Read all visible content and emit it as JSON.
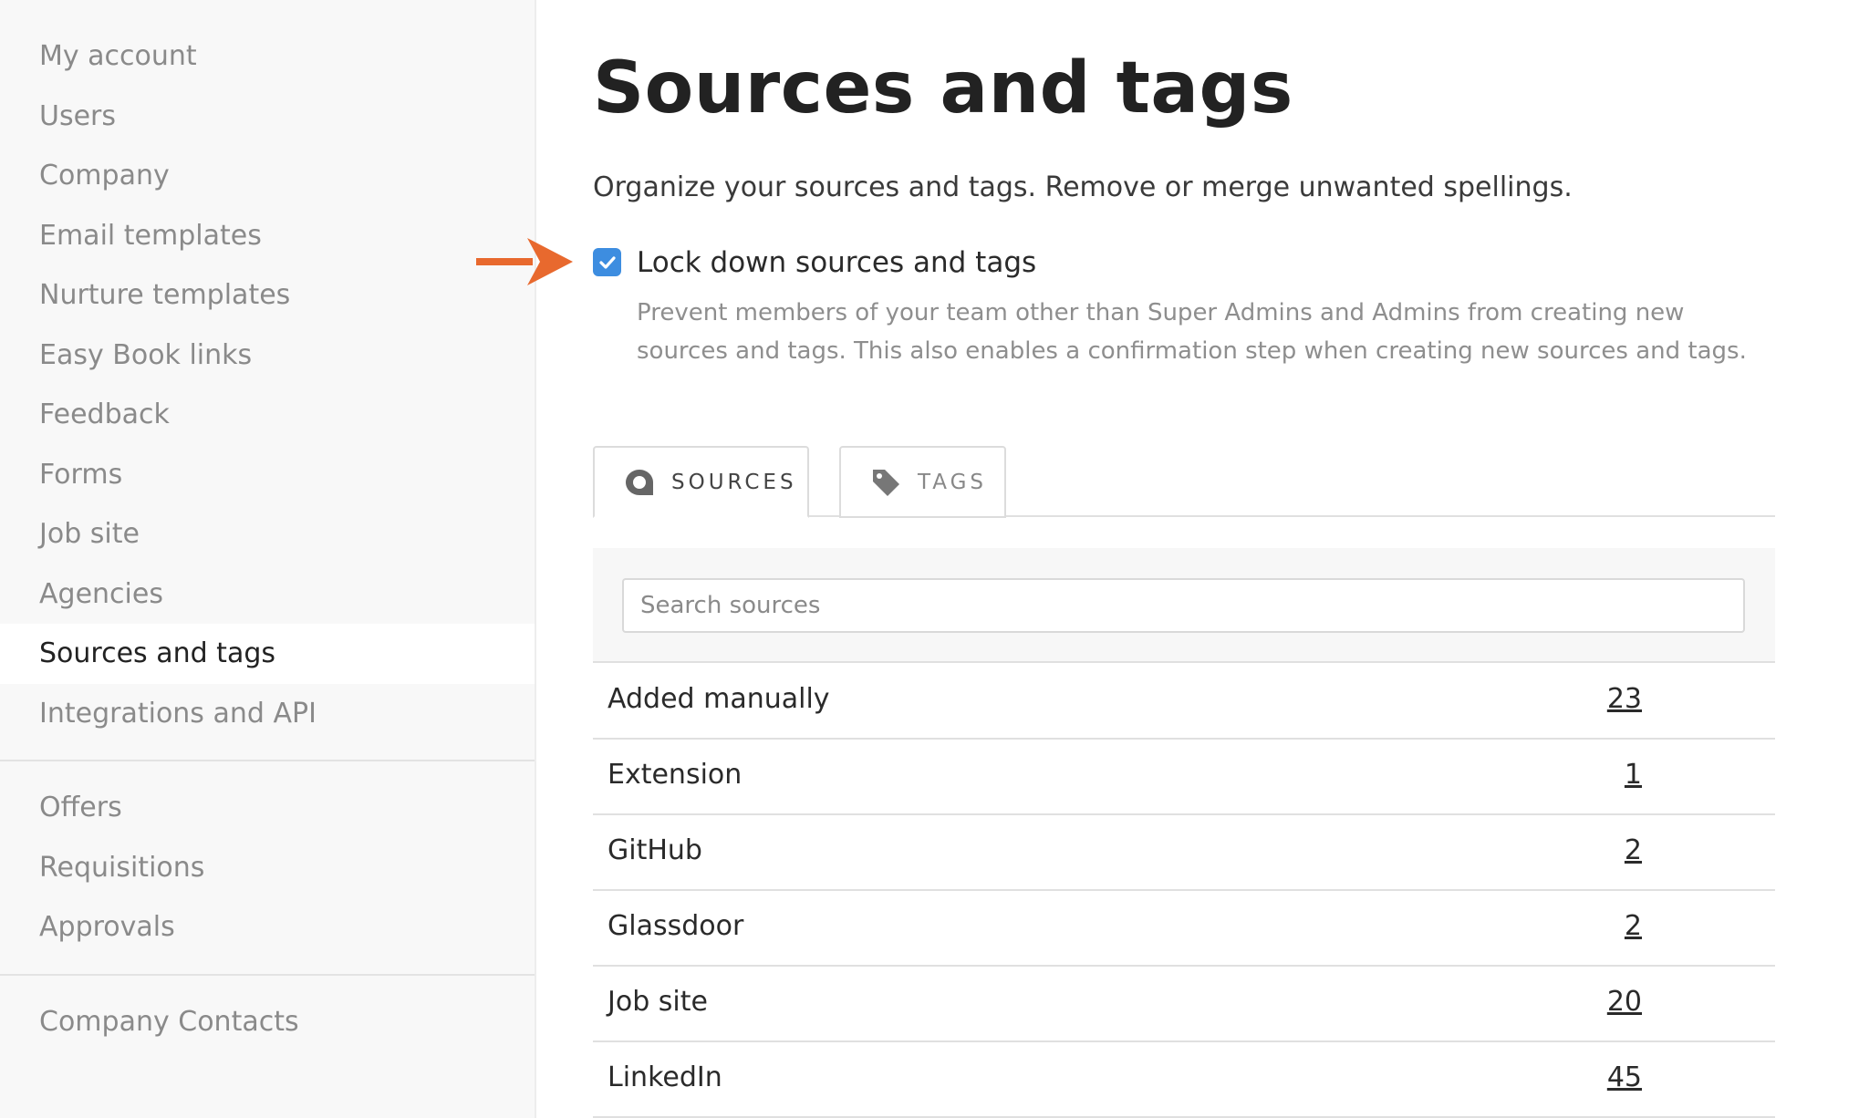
{
  "sidebar": {
    "groups": [
      {
        "items": [
          {
            "label": "My account"
          },
          {
            "label": "Users"
          },
          {
            "label": "Company"
          },
          {
            "label": "Email templates"
          },
          {
            "label": "Nurture templates"
          },
          {
            "label": "Easy Book links"
          },
          {
            "label": "Feedback"
          },
          {
            "label": "Forms"
          },
          {
            "label": "Job site"
          },
          {
            "label": "Agencies"
          },
          {
            "label": "Sources and tags",
            "active": true
          },
          {
            "label": "Integrations and API"
          }
        ]
      },
      {
        "items": [
          {
            "label": "Offers"
          },
          {
            "label": "Requisitions"
          },
          {
            "label": "Approvals"
          }
        ]
      },
      {
        "items": [
          {
            "label": "Company Contacts"
          }
        ]
      }
    ]
  },
  "main": {
    "title": "Sources and tags",
    "subtitle": "Organize your sources and tags. Remove or merge unwanted spellings.",
    "lock": {
      "checked": true,
      "label": "Lock down sources and tags",
      "description": "Prevent members of your team other than Super Admins and Admins from creating new sources and tags. This also enables a confirmation step when creating new sources and tags."
    },
    "tabs": [
      {
        "label": "SOURCES",
        "icon": "chat-bubble-icon",
        "active": true
      },
      {
        "label": "TAGS",
        "icon": "tag-icon",
        "active": false
      }
    ],
    "search": {
      "placeholder": "Search sources",
      "value": ""
    },
    "sources": [
      {
        "name": "Added manually",
        "count": "23"
      },
      {
        "name": "Extension",
        "count": "1"
      },
      {
        "name": "GitHub",
        "count": "2"
      },
      {
        "name": "Glassdoor",
        "count": "2"
      },
      {
        "name": "Job site",
        "count": "20"
      },
      {
        "name": "LinkedIn",
        "count": "45"
      }
    ]
  },
  "colors": {
    "accent": "#3d8de0",
    "annotation_arrow": "#e8692e",
    "sidebar_bg": "#f8f8f8"
  }
}
